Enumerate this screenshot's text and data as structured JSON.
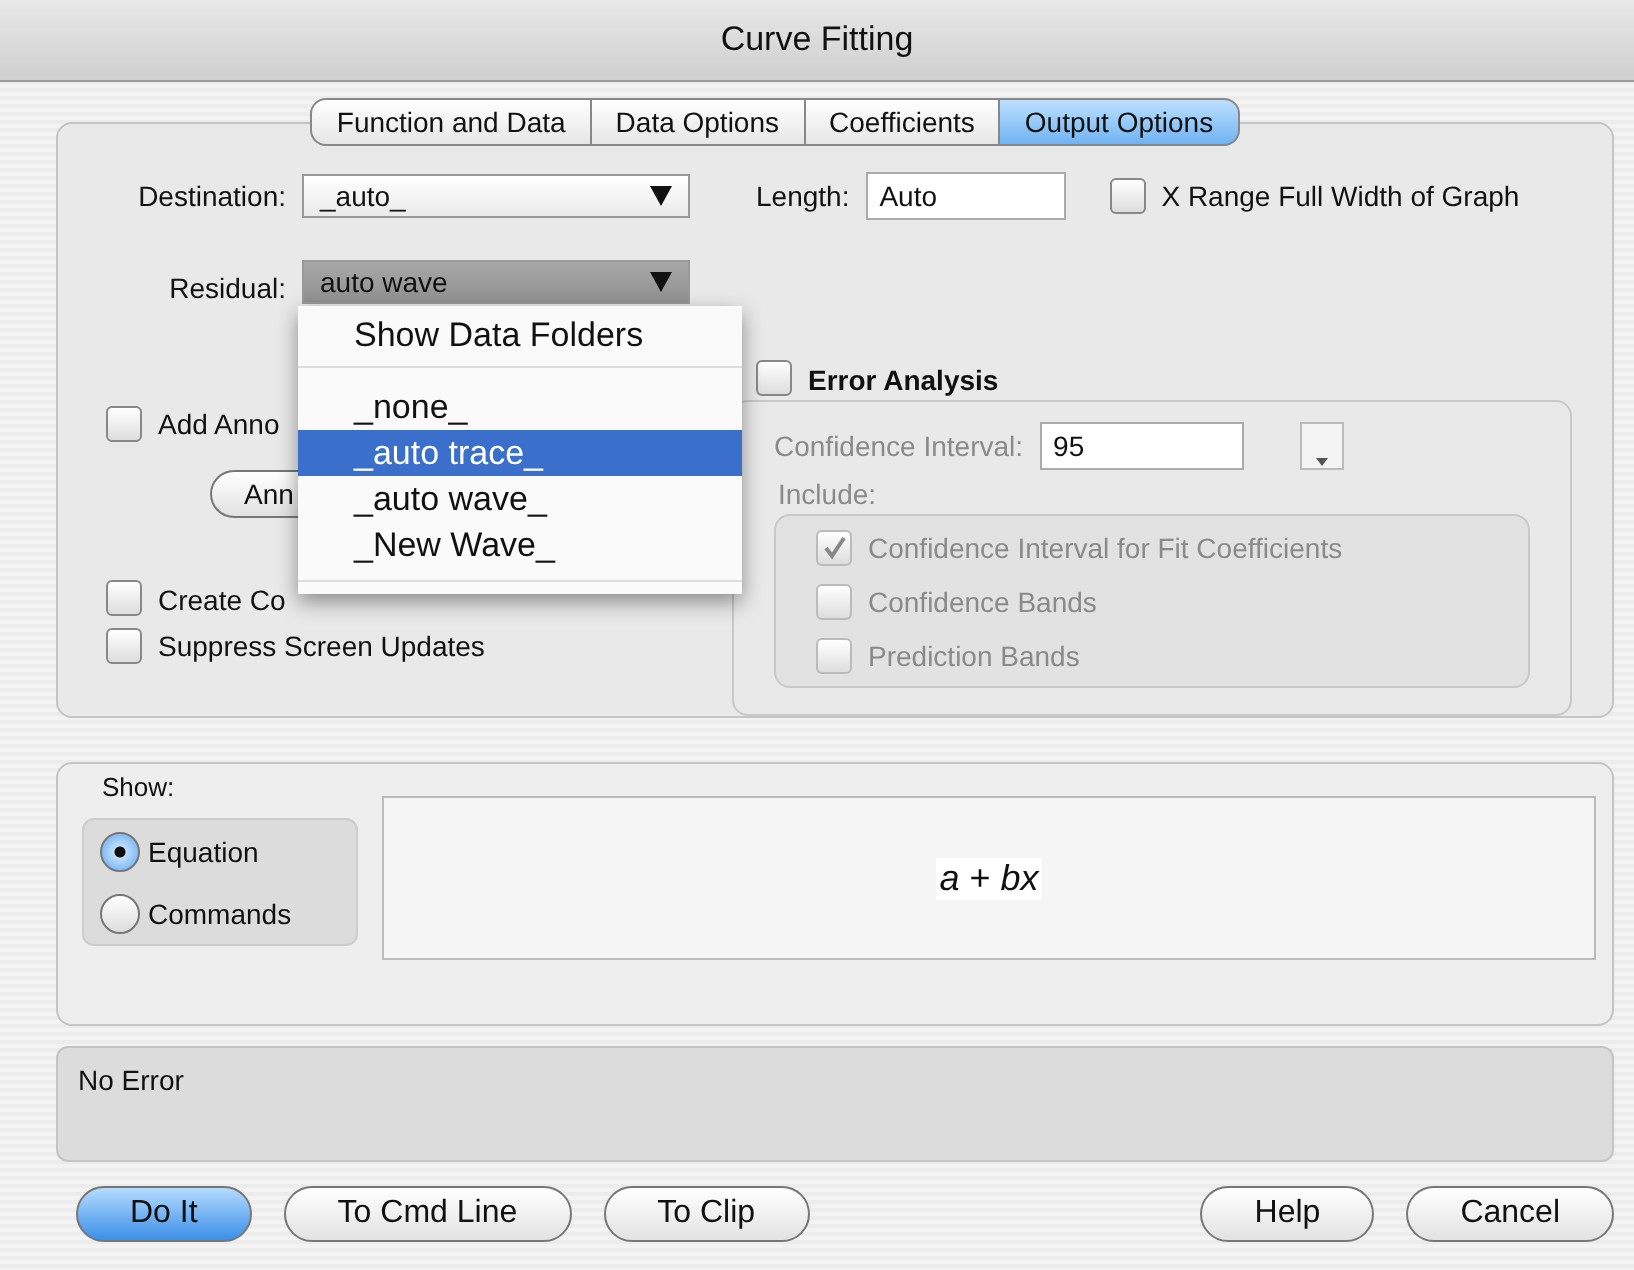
{
  "window": {
    "title": "Curve Fitting"
  },
  "tabs": [
    {
      "label": "Function and Data",
      "selected": false
    },
    {
      "label": "Data Options",
      "selected": false
    },
    {
      "label": "Coefficients",
      "selected": false
    },
    {
      "label": "Output Options",
      "selected": true
    }
  ],
  "destination": {
    "label": "Destination:",
    "value": "_auto_"
  },
  "length": {
    "label": "Length:",
    "value": "Auto"
  },
  "x_range_full_width": {
    "label": "X Range Full Width of Graph",
    "checked": false
  },
  "residual": {
    "label": "Residual:",
    "value": "auto wave"
  },
  "residual_menu": {
    "header": "Show Data Folders",
    "items": [
      {
        "label": "_none_",
        "selected": false
      },
      {
        "label": "_auto trace_",
        "selected": true
      },
      {
        "label": "_auto wave_",
        "selected": false
      },
      {
        "label": "_New Wave_",
        "selected": false
      }
    ]
  },
  "add_annotation": {
    "label": "Add Anno",
    "checked": false
  },
  "annotation_button": {
    "label": "Ann"
  },
  "create_covariance": {
    "label": "Create Co",
    "checked": false
  },
  "suppress_updates": {
    "label": "Suppress Screen Updates",
    "checked": false
  },
  "error_analysis": {
    "label": "Error Analysis",
    "checked": false,
    "confidence_label": "Confidence Interval:",
    "confidence_value": "95",
    "include_label": "Include:",
    "options": [
      {
        "label": "Confidence Interval for Fit Coefficients",
        "checked": true
      },
      {
        "label": "Confidence Bands",
        "checked": false
      },
      {
        "label": "Prediction Bands",
        "checked": false
      }
    ]
  },
  "show": {
    "label": "Show:",
    "options": [
      {
        "label": "Equation",
        "selected": true
      },
      {
        "label": "Commands",
        "selected": false
      }
    ],
    "equation": "*a* + *bx*"
  },
  "status": "No Error",
  "buttons": [
    {
      "label": "Do It",
      "default": true
    },
    {
      "label": "To Cmd Line",
      "default": false
    },
    {
      "label": "To Clip",
      "default": false
    },
    {
      "label": "Help",
      "default": false
    },
    {
      "label": "Cancel",
      "default": false
    }
  ]
}
